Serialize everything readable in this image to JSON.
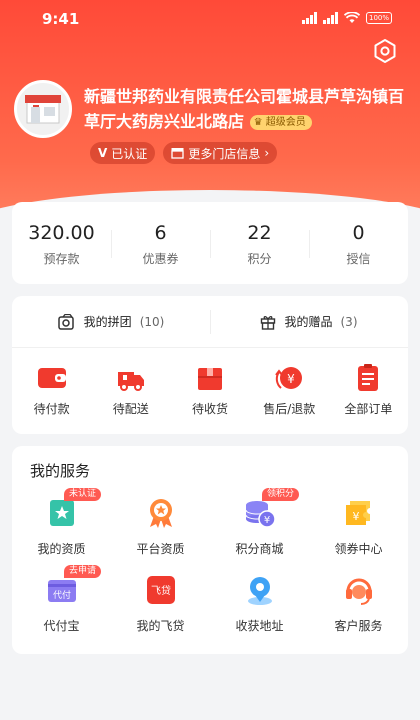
{
  "status_bar": {
    "time": "9:41",
    "battery": "100%"
  },
  "store": {
    "name": "新疆世邦药业有限责任公司霍城县芦草沟镇百草厅大药房兴业北路店",
    "vip_badge": "超级会员",
    "verified_label": "已认证",
    "more_stores_label": "更多门店信息"
  },
  "stats": [
    {
      "value": "320.00",
      "label": "预存款"
    },
    {
      "value": "6",
      "label": "优惠券"
    },
    {
      "value": "22",
      "label": "积分"
    },
    {
      "value": "0",
      "label": "授信"
    }
  ],
  "order_tabs": [
    {
      "label": "我的拼团",
      "count": "(10)"
    },
    {
      "label": "我的赠品",
      "count": "(3)"
    }
  ],
  "orders": [
    {
      "label": "待付款",
      "icon": "wallet-icon"
    },
    {
      "label": "待配送",
      "icon": "truck-icon"
    },
    {
      "label": "待收货",
      "icon": "box-icon"
    },
    {
      "label": "售后/退款",
      "icon": "refund-icon"
    },
    {
      "label": "全部订单",
      "icon": "order-list-icon"
    }
  ],
  "services": {
    "title": "我的服务",
    "items": [
      {
        "label": "我的资质",
        "tag": "未认证",
        "icon": "qualification-icon"
      },
      {
        "label": "平台资质",
        "tag": "",
        "icon": "award-icon"
      },
      {
        "label": "积分商城",
        "tag": "领积分",
        "icon": "coins-icon"
      },
      {
        "label": "领券中心",
        "tag": "",
        "icon": "coupon-icon"
      },
      {
        "label": "代付宝",
        "tag": "去申请",
        "icon": "pay-for-icon",
        "icon_text": "代付"
      },
      {
        "label": "我的飞贷",
        "tag": "",
        "icon": "loan-icon",
        "icon_text": "飞贷"
      },
      {
        "label": "收获地址",
        "tag": "",
        "icon": "location-icon"
      },
      {
        "label": "客户服务",
        "tag": "",
        "icon": "headset-icon"
      }
    ]
  },
  "colors": {
    "brand": "#ff4a38",
    "tag": "#ff5a52",
    "vip": "#ffd36e"
  }
}
